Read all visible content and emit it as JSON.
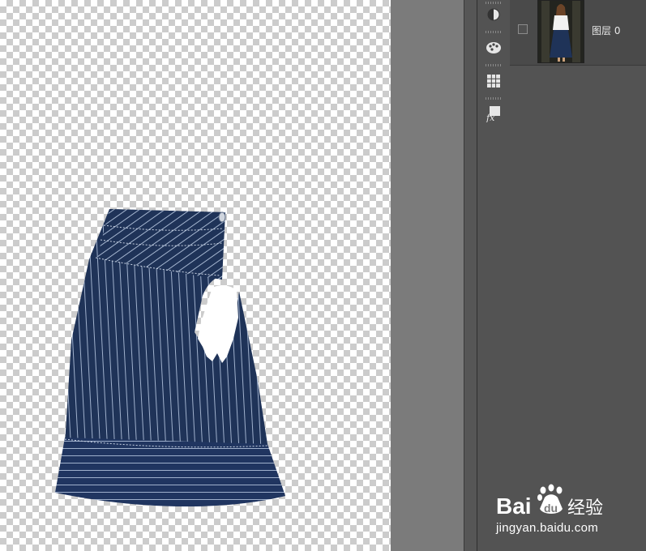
{
  "layers_panel": {
    "layers": [
      {
        "name": "图层 0"
      }
    ]
  },
  "tool_strip": {
    "icons": [
      "adjustments-icon",
      "swatches-icon",
      "grid-icon",
      "styles-icon"
    ]
  },
  "watermark": {
    "logo_text": "Bai du 经验",
    "url": "jingyan.baidu.com"
  }
}
